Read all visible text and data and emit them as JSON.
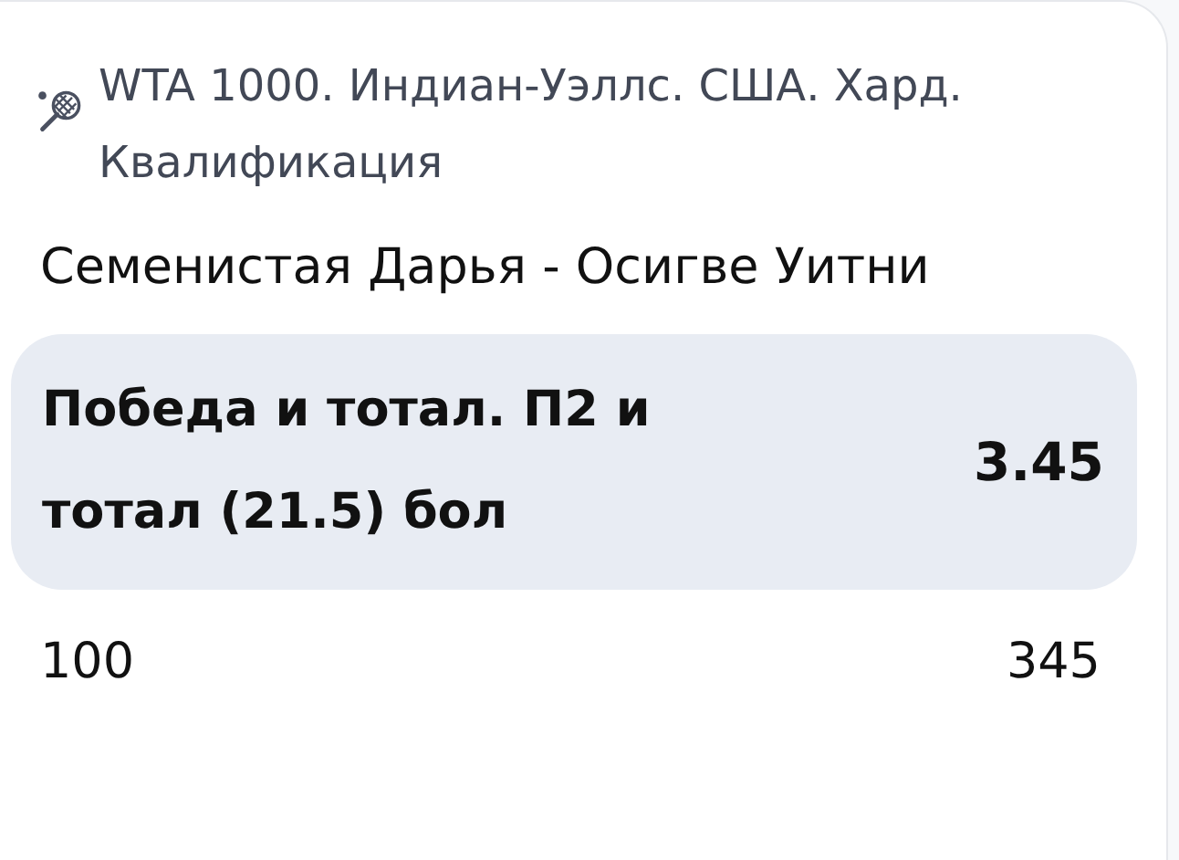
{
  "tournament": "WTA 1000. Индиан-Уэллс. США. Хард. Квалификация",
  "match": "Семенистая Дарья - Осигве Уитни",
  "bet": {
    "market": "Победа и тотал. П2 и тотал (21.5) бол",
    "odds": "3.45"
  },
  "stake": "100",
  "payout": "345"
}
